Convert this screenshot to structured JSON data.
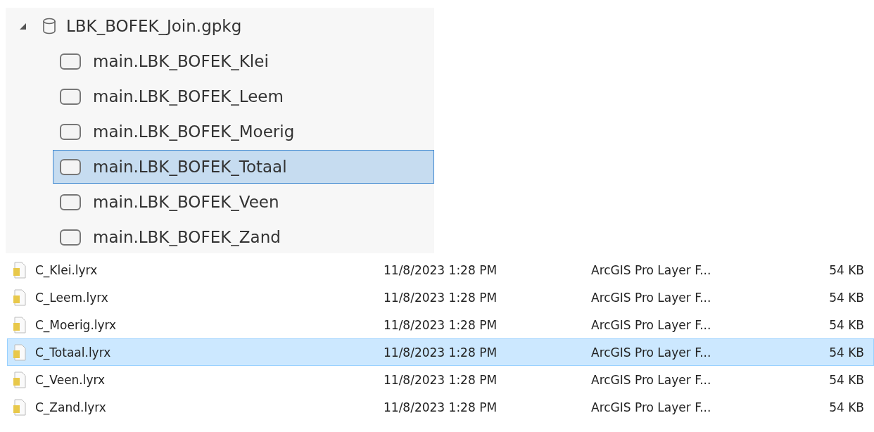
{
  "tree": {
    "label": "LBK_BOFEK_Join.gpkg",
    "expanded": true,
    "children": [
      {
        "label": "main.LBK_BOFEK_Klei",
        "checked": false,
        "selected": false
      },
      {
        "label": "main.LBK_BOFEK_Leem",
        "checked": false,
        "selected": false
      },
      {
        "label": "main.LBK_BOFEK_Moerig",
        "checked": false,
        "selected": false
      },
      {
        "label": "main.LBK_BOFEK_Totaal",
        "checked": false,
        "selected": true
      },
      {
        "label": "main.LBK_BOFEK_Veen",
        "checked": false,
        "selected": false
      },
      {
        "label": "main.LBK_BOFEK_Zand",
        "checked": false,
        "selected": false
      }
    ]
  },
  "files": [
    {
      "name": "C_Klei.lyrx",
      "date": "11/8/2023 1:28 PM",
      "type": "ArcGIS Pro Layer F...",
      "size": "54 KB",
      "selected": false
    },
    {
      "name": "C_Leem.lyrx",
      "date": "11/8/2023 1:28 PM",
      "type": "ArcGIS Pro Layer F...",
      "size": "54 KB",
      "selected": false
    },
    {
      "name": "C_Moerig.lyrx",
      "date": "11/8/2023 1:28 PM",
      "type": "ArcGIS Pro Layer F...",
      "size": "54 KB",
      "selected": false
    },
    {
      "name": "C_Totaal.lyrx",
      "date": "11/8/2023 1:28 PM",
      "type": "ArcGIS Pro Layer F...",
      "size": "54 KB",
      "selected": true
    },
    {
      "name": "C_Veen.lyrx",
      "date": "11/8/2023 1:28 PM",
      "type": "ArcGIS Pro Layer F...",
      "size": "54 KB",
      "selected": false
    },
    {
      "name": "C_Zand.lyrx",
      "date": "11/8/2023 1:28 PM",
      "type": "ArcGIS Pro Layer F...",
      "size": "54 KB",
      "selected": false
    }
  ]
}
